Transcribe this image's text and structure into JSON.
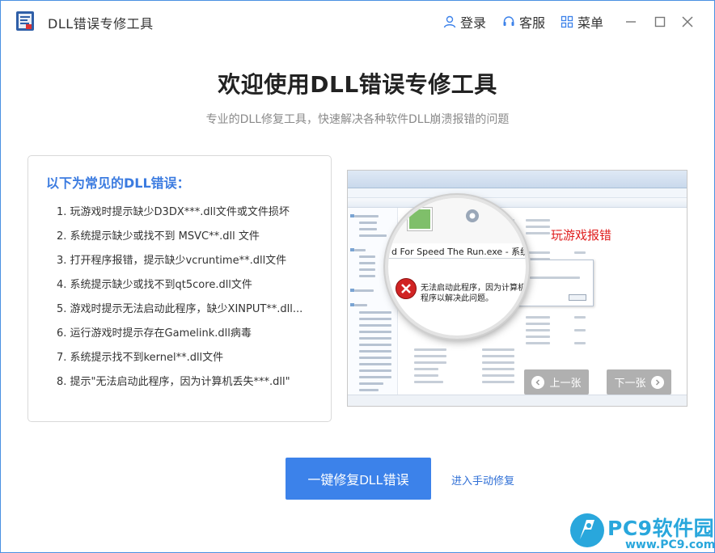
{
  "window": {
    "title": "DLL错误专修工具",
    "actions": {
      "login": "登录",
      "service": "客服",
      "menu": "菜单"
    }
  },
  "header": {
    "title": "欢迎使用DLL错误专修工具",
    "subtitle": "专业的DLL修复工具，快速解决各种软件DLL崩溃报错的问题"
  },
  "errors": {
    "title": "以下为常见的DLL错误：",
    "items": [
      "1. 玩游戏时提示缺少D3DX***.dll文件或文件损坏",
      "2. 系统提示缺少或找不到 MSVC**.dll 文件",
      "3. 打开程序报错，提示缺少vcruntime**.dll文件",
      "4. 系统提示缺少或找不到qt5core.dll文件",
      "5. 游戏时提示无法启动此程序，缺少XINPUT**.dll...",
      "6. 运行游戏时提示存在Gamelink.dll病毒",
      "7. 系统提示找不到kernel**.dll文件",
      "8. 提示\"无法启动此程序，因为计算机丢失***.dll\""
    ]
  },
  "screenshot": {
    "label": "玩游戏报错",
    "dialog_title": "d For Speed The Run.exe - 系统错误",
    "message_line1": "无法启动此程序，因为计算机中丢",
    "message_line2": "程序以解决此问题。",
    "prev": "上一张",
    "next": "下一张"
  },
  "actions": {
    "fix": "一键修复DLL错误",
    "manual": "进入手动修复"
  },
  "watermark": {
    "brand": "PC9软件园",
    "url": "www.PC9.com"
  },
  "colors": {
    "accent": "#3c82ea",
    "link": "#2f6fd6",
    "error_red": "#e02020",
    "watermark": "#29a7dc"
  }
}
